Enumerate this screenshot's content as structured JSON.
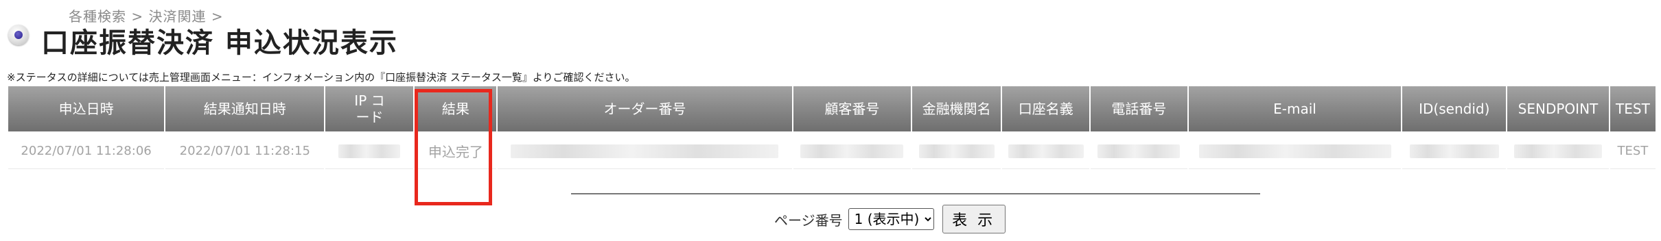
{
  "breadcrumb": "各種検索 > 決済関連 >",
  "page_title": "口座振替決済 申込状況表示",
  "note": "※ステータスの詳細については売上管理画面メニュー：インフォメーション内の『口座振替決済 ステータス一覧』よりご確認ください。",
  "table": {
    "headers": [
      "申込日時",
      "結果通知日時",
      "IP コード",
      "結果",
      "オーダー番号",
      "顧客番号",
      "金融機関名",
      "口座名義",
      "電話番号",
      "E-mail",
      "ID(sendid)",
      "SENDPOINT",
      "TEST"
    ],
    "rows": [
      {
        "apply_datetime": "2022/07/01 11:28:06",
        "notify_datetime": "2022/07/01 11:28:15",
        "result": "申込完了",
        "test": "TEST"
      }
    ]
  },
  "pager": {
    "label": "ページ番号",
    "selected_option": "1 (表示中)",
    "button_label": "表 示"
  },
  "colors": {
    "header_bg": "#8a8a8a",
    "highlight": "#e8281d",
    "cell_text": "#a3a3a3"
  }
}
